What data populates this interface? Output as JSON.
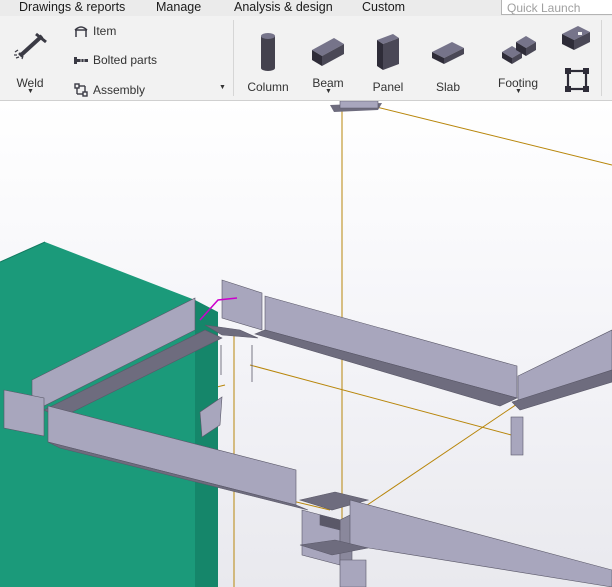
{
  "menu": {
    "items": [
      "Drawings & reports",
      "Manage",
      "Analysis & design",
      "Custom"
    ],
    "quick_launch_placeholder": "Quick Launch"
  },
  "ribbon": {
    "weld": {
      "label": "Weld",
      "icon": "weld-icon"
    },
    "small_buttons": [
      {
        "label": "Item",
        "icon": "item-icon"
      },
      {
        "label": "Bolted parts",
        "icon": "bolted-parts-icon"
      },
      {
        "label": "Assembly",
        "icon": "assembly-icon"
      }
    ],
    "large_buttons": [
      {
        "label": "Column",
        "icon": "column-icon"
      },
      {
        "label": "Beam",
        "icon": "beam-icon"
      },
      {
        "label": "Panel",
        "icon": "panel-icon"
      },
      {
        "label": "Slab",
        "icon": "slab-icon"
      },
      {
        "label": "Footing",
        "icon": "footing-icon"
      }
    ]
  },
  "colors": {
    "steel_face": "#a8a6bd",
    "steel_shadow": "#6e6c7e",
    "concrete_green": "#1b9a7a",
    "grid_line": "#b8860b",
    "highlight": "#cc00cc",
    "menubar": "#ebebeb",
    "ribbon": "#f2f2f2"
  }
}
